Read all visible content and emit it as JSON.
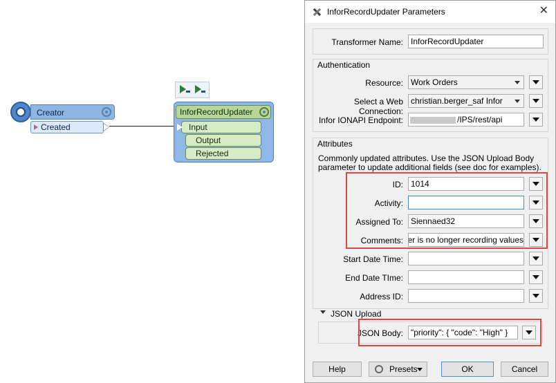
{
  "canvas": {
    "creator": {
      "title": "Creator",
      "port": "Created"
    },
    "transformer": {
      "title": "InforRecordUpdater",
      "input_port": "Input",
      "output_ports": [
        "Output",
        "Rejected"
      ]
    },
    "toolbar_icons": [
      "run-to-this-icon",
      "run-from-this-icon"
    ]
  },
  "dialog": {
    "title": "InforRecordUpdater Parameters",
    "close": "✕",
    "transformer_name_label": "Transformer Name:",
    "transformer_name": "InforRecordUpdater",
    "auth": {
      "section": "Authentication",
      "resource_label": "Resource:",
      "resource": "Work Orders",
      "connection_label": "Select a Web Connection:",
      "connection": "christian.berger_saf Infor",
      "endpoint_label": "Infor IONAPI Endpoint:",
      "endpoint": "/IPS/rest/api"
    },
    "attributes": {
      "section": "Attributes",
      "description": "Commonly updated attributes. Use the JSON Upload Body parameter to update additional fields (see doc for examples).",
      "id_label": "ID:",
      "id": "1014",
      "activity_label": "Activity:",
      "activity": "",
      "assigned_label": "Assigned To:",
      "assigned": "Siennaed32",
      "comments_label": "Comments:",
      "comments": "Meter is no longer recording values",
      "start_label": "Start Date Time:",
      "start": "",
      "end_label": "End Date TIme:",
      "end": "",
      "address_label": "Address ID:",
      "address": ""
    },
    "json_upload": {
      "section": "JSON Upload",
      "body_label": "JSON Body:",
      "body": "\"priority\": { \"code\": \"High\" }"
    },
    "buttons": {
      "help": "Help",
      "presets": "Presets",
      "ok": "OK",
      "cancel": "Cancel"
    }
  },
  "colors": {
    "highlight": "#e04545",
    "transformer_green": "#b7d799",
    "creator_blue": "#8eb6e2"
  }
}
